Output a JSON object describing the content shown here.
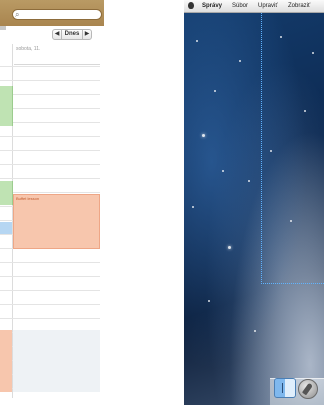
{
  "calendar": {
    "search": {
      "placeholder": ""
    },
    "nav": {
      "prev_label": "◀",
      "today_label": "Dnes",
      "next_label": "▶"
    },
    "day_label": "sobota, 11.",
    "event_title": "Buffet lesson"
  },
  "desktop": {
    "menubar": {
      "apple_icon": "apple-icon",
      "items": [
        "Správy",
        "Súbor",
        "Upraviť",
        "Zobraziť"
      ]
    },
    "dock": {
      "items": [
        {
          "name": "Finder",
          "icon": "finder-icon"
        },
        {
          "name": "Launchpad",
          "icon": "launchpad-icon"
        }
      ]
    }
  },
  "colors": {
    "calendar_toolbar": "#a9854f",
    "event_green": "#bfe3b3",
    "event_orange": "#f7c6ad",
    "event_blue": "#b6d6f2",
    "desktop_blue": "#0d2a52",
    "selection_guide": "#5fb4ff"
  }
}
